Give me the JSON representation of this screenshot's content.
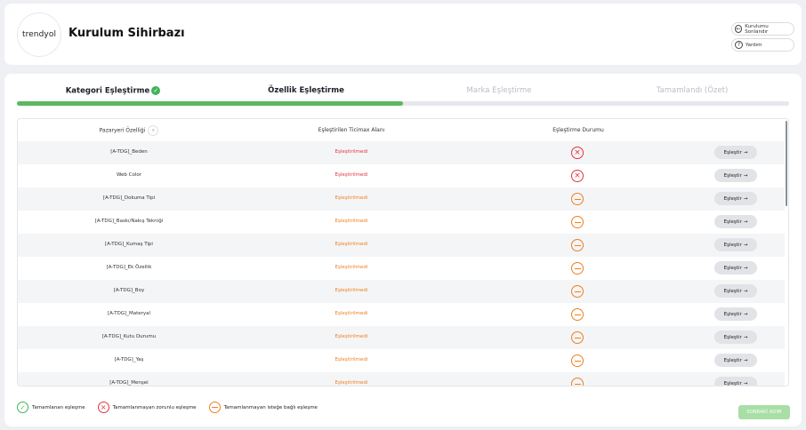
{
  "header": {
    "logo_text": "trendyol",
    "title": "Kurulum Sihirbazı",
    "exit_label": "Kurulumu Sonlandır",
    "help_label": "Yardım"
  },
  "steps": [
    {
      "label": "Kategori Eşleştirme",
      "state": "completed"
    },
    {
      "label": "Özellik Eşleştirme",
      "state": "active"
    },
    {
      "label": "Marka Eşleştirme",
      "state": "inactive"
    },
    {
      "label": "Tamamlandı (Özet)",
      "state": "inactive"
    }
  ],
  "progress_fraction": 0.5,
  "table": {
    "headers": {
      "attribute": "Pazaryeri Özelliği",
      "mapped": "Eşleştirilen Ticimax Alanı",
      "status": "Eşleştirme Durumu"
    },
    "rows": [
      {
        "attribute": "[A-TDG]_Beden",
        "mapped": "Eşleştirilmedi",
        "status": "required"
      },
      {
        "attribute": "Web Color",
        "mapped": "Eşleştirilmedi",
        "status": "required"
      },
      {
        "attribute": "[A-TDG]_Dokuma Tipi",
        "mapped": "Eşleştirilmedi",
        "status": "optional"
      },
      {
        "attribute": "[A-TDG]_Baskı/Nakış Tekniği",
        "mapped": "Eşleştirilmedi",
        "status": "optional"
      },
      {
        "attribute": "[A-TDG]_Kumaş Tipi",
        "mapped": "Eşleştirilmedi",
        "status": "optional"
      },
      {
        "attribute": "[A-TDG]_Ek Özellik",
        "mapped": "Eşleştirilmedi",
        "status": "optional"
      },
      {
        "attribute": "[A-TDG]_Boy",
        "mapped": "Eşleştirilmedi",
        "status": "optional"
      },
      {
        "attribute": "[A-TDG]_Materyal",
        "mapped": "Eşleştirilmedi",
        "status": "optional"
      },
      {
        "attribute": "[A-TDG]_Kutu Durumu",
        "mapped": "Eşleştirilmedi",
        "status": "optional"
      },
      {
        "attribute": "[A-TDG]_Yaş",
        "mapped": "Eşleştirilmedi",
        "status": "optional"
      },
      {
        "attribute": "[A-TDG]_Menşei",
        "mapped": "Eşleştirilmedi",
        "status": "optional"
      }
    ],
    "action_label": "Eşleştir"
  },
  "legend": {
    "done": "Tamamlanan eşleşme",
    "required": "Tamamlanmayan zorunlu eşleşme",
    "optional": "Tamamlanmayan isteğe bağlı eşleşme"
  },
  "next_label": "SONRAKİ ADIM",
  "colors": {
    "accent_green": "#5cb860",
    "error_red": "#e2353f",
    "warning_orange": "#f07f1f"
  }
}
